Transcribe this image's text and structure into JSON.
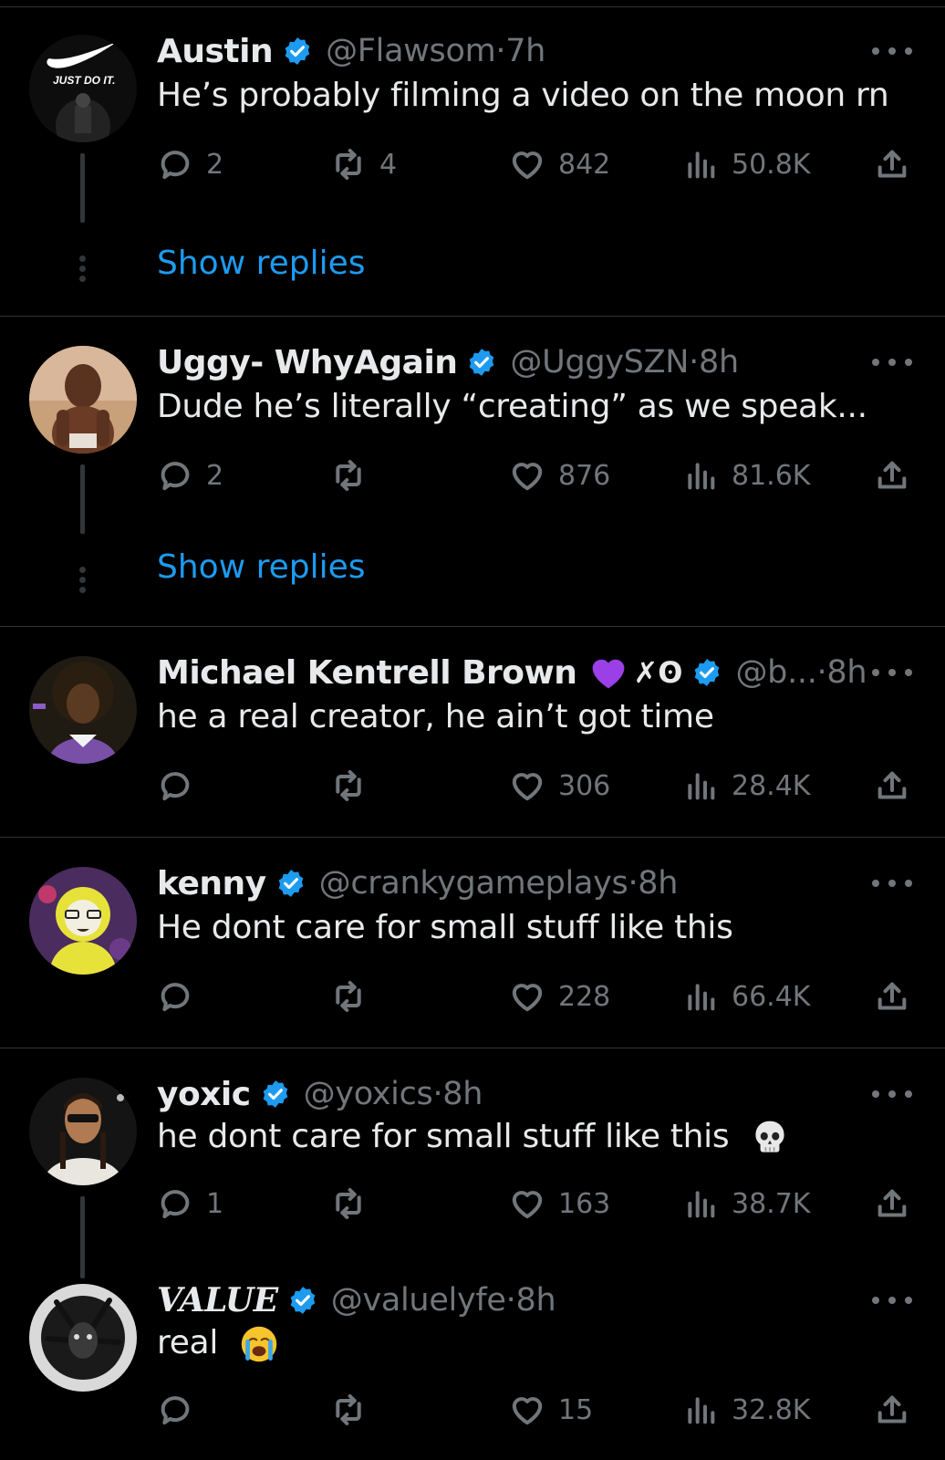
{
  "colors": {
    "background": "#000000",
    "text": "#e7e9ea",
    "muted": "#71767b",
    "accent": "#1d9bf0",
    "divider": "#2f3336"
  },
  "icons": {
    "reply": "reply-icon",
    "retweet": "retweet-icon",
    "like": "heart-icon",
    "views": "views-icon",
    "share": "share-icon",
    "verified": "verified-badge-icon",
    "more": "more-options-icon"
  },
  "tweets": [
    {
      "name": "Austin",
      "handle": "@Flawsom",
      "time": "·7h",
      "text": "He’s probably filming a video on the moon rn",
      "replies": "2",
      "retweets": "4",
      "likes": "842",
      "views": "50.8K",
      "avatar_text": "JUST DO IT.",
      "show_replies": "Show replies"
    },
    {
      "name": "Uggy- WhyAgain",
      "handle": "@UggySZN",
      "time": "·8h",
      "text": "Dude he’s literally “creating” as we speak...",
      "replies": "2",
      "retweets": "",
      "likes": "876",
      "views": "81.6K",
      "show_replies": "Show replies"
    },
    {
      "name": "Michael Kentrell Brown",
      "name_suffix": "✗ʘ",
      "handle": "@b...",
      "time": "·8h",
      "text": "he a real creator, he ain’t got time",
      "replies": "",
      "retweets": "",
      "likes": "306",
      "views": "28.4K"
    },
    {
      "name": "kenny",
      "handle": "@crankygameplays",
      "time": "·8h",
      "text": "He dont care for small stuff like this",
      "replies": "",
      "retweets": "",
      "likes": "228",
      "views": "66.4K"
    },
    {
      "name": "yoxic",
      "handle": "@yoxics",
      "time": "·8h",
      "text": "he dont care for small stuff like this",
      "text_emoji": "skull-emoji",
      "replies": "1",
      "retweets": "",
      "likes": "163",
      "views": "38.7K"
    },
    {
      "name": "VALUE",
      "handle": "@valuelyfe",
      "time": "·8h",
      "text": "real",
      "text_emoji": "loudly-crying-face-emoji",
      "replies": "",
      "retweets": "",
      "likes": "15",
      "views": "32.8K"
    }
  ]
}
